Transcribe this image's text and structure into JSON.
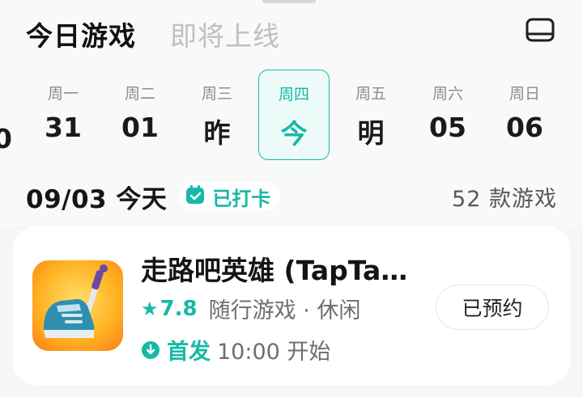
{
  "tabs": {
    "today": "今日游戏",
    "upcoming": "即将上线"
  },
  "layout_icon": "layout-toggle-icon",
  "week": {
    "partial_date": "0",
    "days": [
      {
        "name": "周一",
        "date": "31"
      },
      {
        "name": "周二",
        "date": "01"
      },
      {
        "name": "周三",
        "date": "昨"
      },
      {
        "name": "周四",
        "date": "今"
      },
      {
        "name": "周五",
        "date": "明"
      },
      {
        "name": "周六",
        "date": "05"
      },
      {
        "name": "周日",
        "date": "06"
      }
    ],
    "selected_index": 3
  },
  "summary": {
    "date_label": "09/03 今天",
    "checkin_label": "已打卡",
    "checkin_icon": "calendar-check-icon",
    "count_label": "52 款游戏"
  },
  "game": {
    "title": "走路吧英雄 (TapTa…",
    "rating": "7.8",
    "star_icon": "star-icon",
    "meta": "随行游戏 · 休闲",
    "release_icon": "download-icon",
    "release_label": "首发",
    "start_time": "10:00 开始",
    "reserve_button": "已预约"
  },
  "colors": {
    "accent": "#16b9a5",
    "muted": "#bdbfc2",
    "background": "#f5f6f7"
  }
}
